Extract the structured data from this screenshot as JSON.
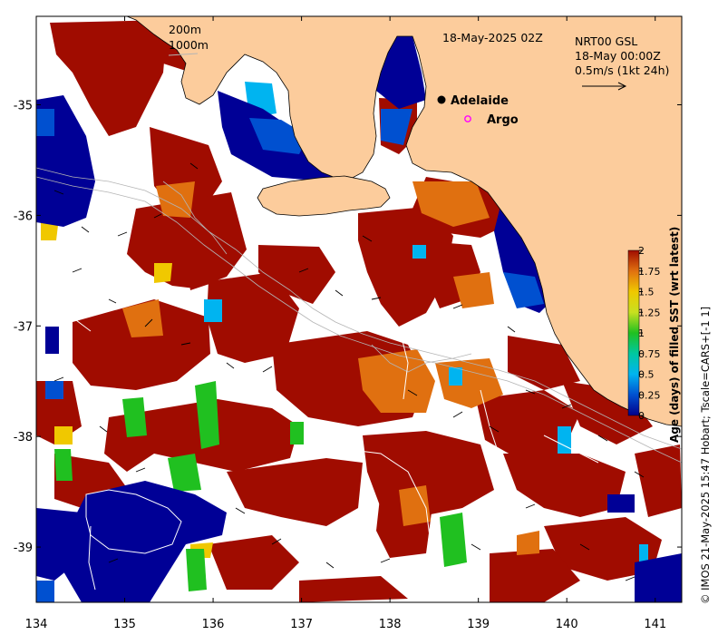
{
  "figure": {
    "map_timestamp": "18-May-2025 02Z",
    "legend_contours": [
      "200m",
      "1000m"
    ],
    "current_info": {
      "product": "NRT00 GSL",
      "time": "18-May 00:00Z",
      "scale": "0.5m/s (1kt 24h)"
    },
    "places": [
      {
        "name": "Adelaide",
        "lon": 138.6,
        "lat": -34.93,
        "marker": "filled-dot"
      },
      {
        "name": "Argo",
        "lon": 138.78,
        "lat": -35.12,
        "marker": "open-circle"
      }
    ],
    "credit": "© IMOS 21-May-2025 15:47 Hobart; Tscale=CARS+[-1 1]"
  },
  "axes": {
    "x_ticks": [
      "134",
      "135",
      "136",
      "137",
      "138",
      "139",
      "140",
      "141"
    ],
    "x_values": [
      134,
      135,
      136,
      137,
      138,
      139,
      140,
      141
    ],
    "y_ticks": [
      "-35",
      "-36",
      "-37",
      "-38",
      "-39"
    ],
    "y_values": [
      -35,
      -36,
      -37,
      -38,
      -39
    ],
    "xlim": [
      134,
      141.3
    ],
    "ylim": [
      -39.5,
      -34.2
    ]
  },
  "colorbar": {
    "label": "Age (days) of filled SST (wrt latest)",
    "tick_labels": [
      "2",
      "1.75",
      "1.5",
      "1.25",
      "1",
      "0.75",
      "0.5",
      "0.25",
      "0"
    ],
    "range": [
      0,
      2
    ],
    "colors": [
      "#00008b",
      "#0050d0",
      "#00b4f0",
      "#00c8a0",
      "#20c020",
      "#c8e020",
      "#f0c800",
      "#e07010",
      "#a00c00"
    ]
  },
  "colors": {
    "land": "#fccc9c",
    "no_data": "#ffffff",
    "age_0_blue": "#000096",
    "age_2_red": "#a00c00"
  }
}
